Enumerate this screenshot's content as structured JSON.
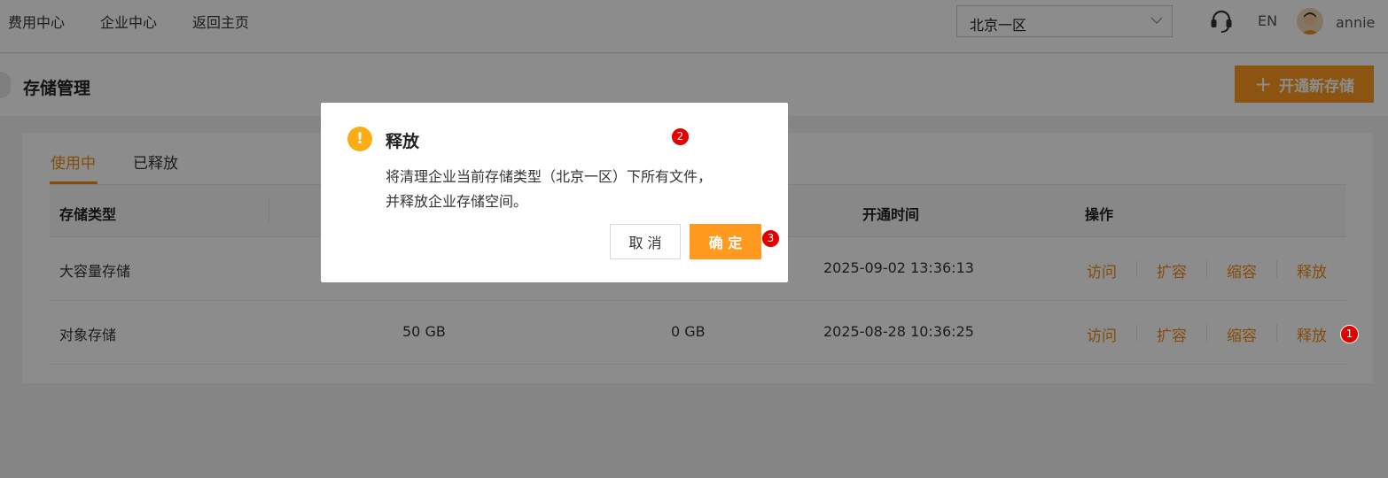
{
  "topbar": {
    "nav": [
      "费用中心",
      "企业中心",
      "返回主页"
    ],
    "region": "北京一区",
    "lang": "EN",
    "username": "annie"
  },
  "page": {
    "title": "存储管理",
    "new_button": "开通新存储"
  },
  "tabs": [
    "使用中",
    "已释放"
  ],
  "table": {
    "headers": {
      "type": "存储类型",
      "open_time": "开通时间",
      "actions": "操作"
    },
    "rows": [
      {
        "type": "大容量存储",
        "capacity": "",
        "used": "",
        "open_time": "2025-09-02 13:36:13"
      },
      {
        "type": "对象存储",
        "capacity": "50 GB",
        "used": "0 GB",
        "open_time": "2025-08-28 10:36:25"
      }
    ],
    "actions": [
      "访问",
      "扩容",
      "缩容",
      "释放"
    ]
  },
  "dialog": {
    "icon": "warning-icon",
    "title": "释放",
    "message_line1": "将清理企业当前存储类型（北京一区）下所有文件，",
    "message_line2": "并释放企业存储空间。",
    "cancel": "取 消",
    "confirm": "确 定"
  },
  "badges": [
    "1",
    "2",
    "3"
  ],
  "colors": {
    "accent": "#f08a14",
    "button": "#ff9a1f",
    "warning": "#faad14",
    "badge": "#e00000"
  }
}
